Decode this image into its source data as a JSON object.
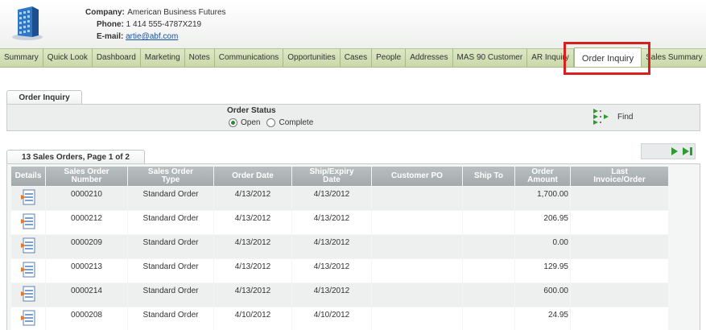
{
  "company": {
    "company_label": "Company:",
    "company_value": "American Business Futures",
    "phone_label": "Phone:",
    "phone_value": "1 414 555-4787X219",
    "email_label": "E-mail:",
    "email_value": "artie@abf.com"
  },
  "tabs": [
    {
      "label": "Summary"
    },
    {
      "label": "Quick Look"
    },
    {
      "label": "Dashboard"
    },
    {
      "label": "Marketing"
    },
    {
      "label": "Notes"
    },
    {
      "label": "Communications"
    },
    {
      "label": "Opportunities"
    },
    {
      "label": "Cases"
    },
    {
      "label": "People"
    },
    {
      "label": "Addresses"
    },
    {
      "label": "MAS 90 Customer"
    },
    {
      "label": "AR Inquiry"
    },
    {
      "label": "Order Inquiry"
    },
    {
      "label": "Sales Summary"
    }
  ],
  "active_tab": "Order Inquiry",
  "order_inquiry": {
    "tab_label": "Order Inquiry",
    "status_label": "Order Status",
    "option_open": "Open",
    "option_complete": "Complete",
    "selected": "Open",
    "find_label": "Find"
  },
  "sales_orders": {
    "tab_label": "13 Sales Orders, Page 1 of 2",
    "columns": {
      "details": "Details",
      "number_1": "Sales Order",
      "number_2": "Number",
      "type_1": "Sales Order",
      "type_2": "Type",
      "order_date": "Order Date",
      "ship_1": "Ship/Expiry",
      "ship_2": "Date",
      "customer_po": "Customer PO",
      "ship_to": "Ship To",
      "amount_1": "Order",
      "amount_2": "Amount",
      "last_1": "Last",
      "last_2": "Invoice/Order"
    },
    "rows": [
      {
        "number": "0000210",
        "type": "Standard Order",
        "order_date": "4/13/2012",
        "ship_date": "4/13/2012",
        "customer_po": "",
        "ship_to": "",
        "amount": "1,700.00",
        "last": ""
      },
      {
        "number": "0000212",
        "type": "Standard Order",
        "order_date": "4/13/2012",
        "ship_date": "4/13/2012",
        "customer_po": "",
        "ship_to": "",
        "amount": "206.95",
        "last": ""
      },
      {
        "number": "0000209",
        "type": "Standard Order",
        "order_date": "4/13/2012",
        "ship_date": "4/13/2012",
        "customer_po": "",
        "ship_to": "",
        "amount": "0.00",
        "last": ""
      },
      {
        "number": "0000213",
        "type": "Standard Order",
        "order_date": "4/13/2012",
        "ship_date": "4/13/2012",
        "customer_po": "",
        "ship_to": "",
        "amount": "129.95",
        "last": ""
      },
      {
        "number": "0000214",
        "type": "Standard Order",
        "order_date": "4/13/2012",
        "ship_date": "4/13/2012",
        "customer_po": "",
        "ship_to": "",
        "amount": "600.00",
        "last": ""
      },
      {
        "number": "0000208",
        "type": "Standard Order",
        "order_date": "4/10/2012",
        "ship_date": "4/10/2012",
        "customer_po": "",
        "ship_to": "",
        "amount": "24.95",
        "last": ""
      }
    ]
  },
  "colors": {
    "tab_bar": "#c9d8a8",
    "grid_header": "#a4aaac",
    "highlight": "#d82020",
    "link": "#1a4fa0"
  },
  "icons": {
    "logo": "building-icon",
    "find": "find-icon",
    "details": "document-icon",
    "next": "next-page-icon",
    "last": "last-page-icon"
  }
}
